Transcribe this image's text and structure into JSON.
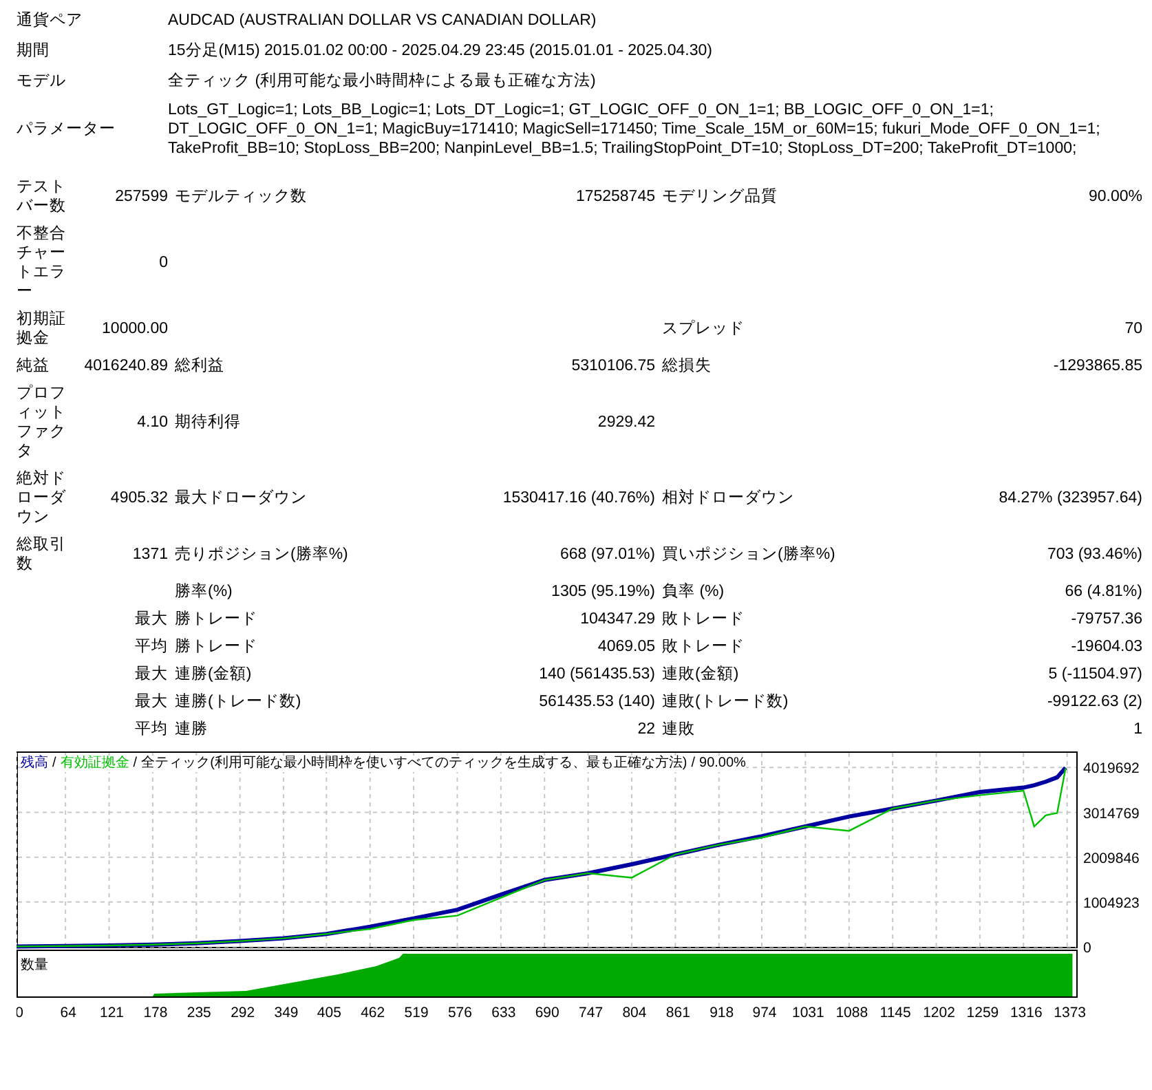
{
  "header": [
    {
      "label": "通貨ペア",
      "value": "AUDCAD (AUSTRALIAN DOLLAR VS CANADIAN DOLLAR)"
    },
    {
      "label": "期間",
      "value": "15分足(M15) 2015.01.02 00:00 - 2025.04.29 23:45 (2015.01.01 - 2025.04.30)"
    },
    {
      "label": "モデル",
      "value": "全ティック (利用可能な最小時間枠による最も正確な方法)"
    },
    {
      "label": "パラメーター",
      "value": "Lots_GT_Logic=1; Lots_BB_Logic=1; Lots_DT_Logic=1; GT_LOGIC_OFF_0_ON_1=1; BB_LOGIC_OFF_0_ON_1=1; DT_LOGIC_OFF_0_ON_1=1; MagicBuy=171410; MagicSell=171450; Time_Scale_15M_or_60M=15; fukuri_Mode_OFF_0_ON_1=1; TakeProfit_BB=10; StopLoss_BB=200; NanpinLevel_BB=1.5; TrailingStopPoint_DT=10; StopLoss_DT=200; TakeProfit_DT=1000;"
    }
  ],
  "stats": [
    {
      "label": "テストバー数",
      "value": "257599",
      "left": {
        "label": "モデルティック数",
        "value": "175258745"
      },
      "right": {
        "label": "モデリング品質",
        "value": "90.00%"
      }
    },
    {
      "label": "不整合チャートエラー",
      "value": "0"
    },
    {
      "label": "初期証拠金",
      "value": "10000.00",
      "right": {
        "label": "スプレッド",
        "value": "70"
      }
    },
    {
      "label": "純益",
      "value": "4016240.89",
      "left": {
        "label": "総利益",
        "value": "5310106.75"
      },
      "right": {
        "label": "総損失",
        "value": "-1293865.85"
      }
    },
    {
      "label": "プロフィットファクタ",
      "value": "4.10",
      "left": {
        "label": "期待利得",
        "value": "2929.42"
      }
    },
    {
      "label": "絶対ドローダウン",
      "value": "4905.32",
      "left": {
        "label": "最大ドローダウン",
        "value": "1530417.16 (40.76%)"
      },
      "right": {
        "label": "相対ドローダウン",
        "value": "84.27% (323957.64)"
      }
    },
    {
      "label": "総取引数",
      "value": "1371",
      "left": {
        "label": "売りポジション(勝率%)",
        "value": "668 (97.01%)"
      },
      "right": {
        "label": "買いポジション(勝率%)",
        "value": "703 (93.46%)"
      }
    },
    {
      "left": {
        "label": "勝率(%)",
        "value": "1305 (95.19%)"
      },
      "right": {
        "label": "負率 (%)",
        "value": "66 (4.81%)"
      }
    },
    {
      "value": "最大",
      "left": {
        "label": "勝トレード",
        "value": "104347.29"
      },
      "right": {
        "label": "敗トレード",
        "value": "-79757.36"
      }
    },
    {
      "value": "平均",
      "left": {
        "label": "勝トレード",
        "value": "4069.05"
      },
      "right": {
        "label": "敗トレード",
        "value": "-19604.03"
      }
    },
    {
      "value": "最大",
      "left": {
        "label": "連勝(金額)",
        "value": "140 (561435.53)"
      },
      "right": {
        "label": "連敗(金額)",
        "value": "5 (-11504.97)"
      }
    },
    {
      "value": "最大",
      "left": {
        "label": "連勝(トレード数)",
        "value": "561435.53 (140)"
      },
      "right": {
        "label": "連敗(トレード数)",
        "value": "-99122.63 (2)"
      }
    },
    {
      "value": "平均",
      "left": {
        "label": "連勝",
        "value": "22"
      },
      "right": {
        "label": "連敗",
        "value": "1"
      }
    }
  ],
  "chart": {
    "legend": [
      {
        "kind": "series"
      },
      {
        "kind": "text",
        "text": "/"
      },
      {
        "kind": "series"
      },
      {
        "kind": "text",
        "text": "/"
      },
      {
        "kind": "text",
        "text": "全ティック(利用可能な最小時間枠を使いすべてのティックを生成する、最も正確な方法)"
      },
      {
        "kind": "text",
        "text": "/"
      },
      {
        "kind": "text",
        "text": "90.00%"
      }
    ],
    "volume_label": "数量",
    "chart_data": {
      "type": "line",
      "x": [
        0,
        64,
        121,
        178,
        235,
        292,
        349,
        405,
        462,
        519,
        576,
        633,
        690,
        747,
        804,
        861,
        918,
        974,
        1031,
        1088,
        1145,
        1202,
        1259,
        1316,
        1330,
        1345,
        1360,
        1371
      ],
      "series": [
        {
          "name": "残高",
          "color": "#0000a0",
          "values": [
            10000,
            20000,
            30000,
            50000,
            80000,
            130000,
            190000,
            290000,
            450000,
            640000,
            830000,
            1170000,
            1500000,
            1650000,
            1850000,
            2070000,
            2290000,
            2480000,
            2700000,
            2920000,
            3100000,
            3280000,
            3470000,
            3570000,
            3620000,
            3700000,
            3800000,
            4016000
          ]
        },
        {
          "name": "有効証拠金",
          "color": "#00c000",
          "values": [
            10000,
            20000,
            30000,
            50000,
            80000,
            130000,
            190000,
            290000,
            400000,
            600000,
            700000,
            1100000,
            1500000,
            1650000,
            1550000,
            2070000,
            2290000,
            2450000,
            2700000,
            2600000,
            3100000,
            3280000,
            3400000,
            3500000,
            2700000,
            2950000,
            3000000,
            4000000
          ]
        }
      ],
      "xticks": [
        0,
        64,
        121,
        178,
        235,
        292,
        349,
        405,
        462,
        519,
        576,
        633,
        690,
        747,
        804,
        861,
        918,
        974,
        1031,
        1088,
        1145,
        1202,
        1259,
        1316,
        1373
      ],
      "yticks": [
        0,
        1004923,
        2009846,
        3014769,
        4019692
      ],
      "xlim": [
        0,
        1385
      ],
      "ylim": [
        0,
        4380000
      ],
      "grid": true
    }
  }
}
